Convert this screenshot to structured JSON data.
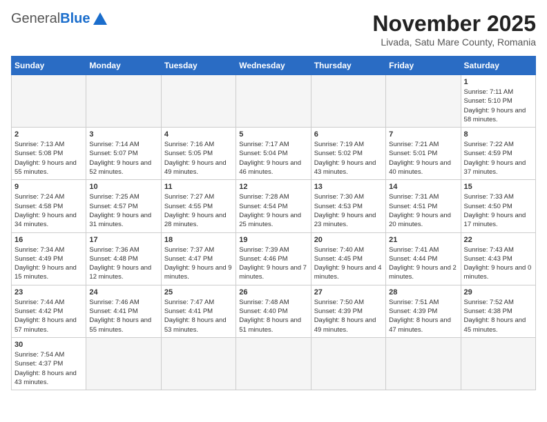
{
  "header": {
    "logo": {
      "general": "General",
      "blue": "Blue"
    },
    "title": "November 2025",
    "subtitle": "Livada, Satu Mare County, Romania"
  },
  "days_of_week": [
    "Sunday",
    "Monday",
    "Tuesday",
    "Wednesday",
    "Thursday",
    "Friday",
    "Saturday"
  ],
  "weeks": [
    [
      {
        "day": "",
        "info": ""
      },
      {
        "day": "",
        "info": ""
      },
      {
        "day": "",
        "info": ""
      },
      {
        "day": "",
        "info": ""
      },
      {
        "day": "",
        "info": ""
      },
      {
        "day": "",
        "info": ""
      },
      {
        "day": "1",
        "info": "Sunrise: 7:11 AM\nSunset: 5:10 PM\nDaylight: 9 hours and 58 minutes."
      }
    ],
    [
      {
        "day": "2",
        "info": "Sunrise: 7:13 AM\nSunset: 5:08 PM\nDaylight: 9 hours and 55 minutes."
      },
      {
        "day": "3",
        "info": "Sunrise: 7:14 AM\nSunset: 5:07 PM\nDaylight: 9 hours and 52 minutes."
      },
      {
        "day": "4",
        "info": "Sunrise: 7:16 AM\nSunset: 5:05 PM\nDaylight: 9 hours and 49 minutes."
      },
      {
        "day": "5",
        "info": "Sunrise: 7:17 AM\nSunset: 5:04 PM\nDaylight: 9 hours and 46 minutes."
      },
      {
        "day": "6",
        "info": "Sunrise: 7:19 AM\nSunset: 5:02 PM\nDaylight: 9 hours and 43 minutes."
      },
      {
        "day": "7",
        "info": "Sunrise: 7:21 AM\nSunset: 5:01 PM\nDaylight: 9 hours and 40 minutes."
      },
      {
        "day": "8",
        "info": "Sunrise: 7:22 AM\nSunset: 4:59 PM\nDaylight: 9 hours and 37 minutes."
      }
    ],
    [
      {
        "day": "9",
        "info": "Sunrise: 7:24 AM\nSunset: 4:58 PM\nDaylight: 9 hours and 34 minutes."
      },
      {
        "day": "10",
        "info": "Sunrise: 7:25 AM\nSunset: 4:57 PM\nDaylight: 9 hours and 31 minutes."
      },
      {
        "day": "11",
        "info": "Sunrise: 7:27 AM\nSunset: 4:55 PM\nDaylight: 9 hours and 28 minutes."
      },
      {
        "day": "12",
        "info": "Sunrise: 7:28 AM\nSunset: 4:54 PM\nDaylight: 9 hours and 25 minutes."
      },
      {
        "day": "13",
        "info": "Sunrise: 7:30 AM\nSunset: 4:53 PM\nDaylight: 9 hours and 23 minutes."
      },
      {
        "day": "14",
        "info": "Sunrise: 7:31 AM\nSunset: 4:51 PM\nDaylight: 9 hours and 20 minutes."
      },
      {
        "day": "15",
        "info": "Sunrise: 7:33 AM\nSunset: 4:50 PM\nDaylight: 9 hours and 17 minutes."
      }
    ],
    [
      {
        "day": "16",
        "info": "Sunrise: 7:34 AM\nSunset: 4:49 PM\nDaylight: 9 hours and 15 minutes."
      },
      {
        "day": "17",
        "info": "Sunrise: 7:36 AM\nSunset: 4:48 PM\nDaylight: 9 hours and 12 minutes."
      },
      {
        "day": "18",
        "info": "Sunrise: 7:37 AM\nSunset: 4:47 PM\nDaylight: 9 hours and 9 minutes."
      },
      {
        "day": "19",
        "info": "Sunrise: 7:39 AM\nSunset: 4:46 PM\nDaylight: 9 hours and 7 minutes."
      },
      {
        "day": "20",
        "info": "Sunrise: 7:40 AM\nSunset: 4:45 PM\nDaylight: 9 hours and 4 minutes."
      },
      {
        "day": "21",
        "info": "Sunrise: 7:41 AM\nSunset: 4:44 PM\nDaylight: 9 hours and 2 minutes."
      },
      {
        "day": "22",
        "info": "Sunrise: 7:43 AM\nSunset: 4:43 PM\nDaylight: 9 hours and 0 minutes."
      }
    ],
    [
      {
        "day": "23",
        "info": "Sunrise: 7:44 AM\nSunset: 4:42 PM\nDaylight: 8 hours and 57 minutes."
      },
      {
        "day": "24",
        "info": "Sunrise: 7:46 AM\nSunset: 4:41 PM\nDaylight: 8 hours and 55 minutes."
      },
      {
        "day": "25",
        "info": "Sunrise: 7:47 AM\nSunset: 4:41 PM\nDaylight: 8 hours and 53 minutes."
      },
      {
        "day": "26",
        "info": "Sunrise: 7:48 AM\nSunset: 4:40 PM\nDaylight: 8 hours and 51 minutes."
      },
      {
        "day": "27",
        "info": "Sunrise: 7:50 AM\nSunset: 4:39 PM\nDaylight: 8 hours and 49 minutes."
      },
      {
        "day": "28",
        "info": "Sunrise: 7:51 AM\nSunset: 4:39 PM\nDaylight: 8 hours and 47 minutes."
      },
      {
        "day": "29",
        "info": "Sunrise: 7:52 AM\nSunset: 4:38 PM\nDaylight: 8 hours and 45 minutes."
      }
    ],
    [
      {
        "day": "30",
        "info": "Sunrise: 7:54 AM\nSunset: 4:37 PM\nDaylight: 8 hours and 43 minutes."
      },
      {
        "day": "",
        "info": ""
      },
      {
        "day": "",
        "info": ""
      },
      {
        "day": "",
        "info": ""
      },
      {
        "day": "",
        "info": ""
      },
      {
        "day": "",
        "info": ""
      },
      {
        "day": "",
        "info": ""
      }
    ]
  ]
}
